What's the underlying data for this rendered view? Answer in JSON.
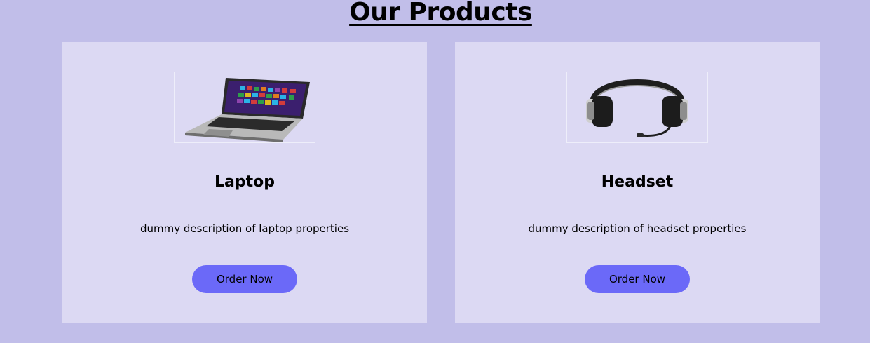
{
  "page": {
    "title": "Our Products"
  },
  "products": [
    {
      "image_icon": "laptop-image",
      "name": "Laptop",
      "description": "dummy description of laptop properties",
      "button_label": "Order Now"
    },
    {
      "image_icon": "headset-image",
      "name": "Headset",
      "description": "dummy description of headset properties",
      "button_label": "Order Now"
    }
  ],
  "colors": {
    "page_background": "#c1bee9",
    "card_background": "#dcd9f3",
    "button_background": "#6b69f8",
    "text": "#000000"
  }
}
